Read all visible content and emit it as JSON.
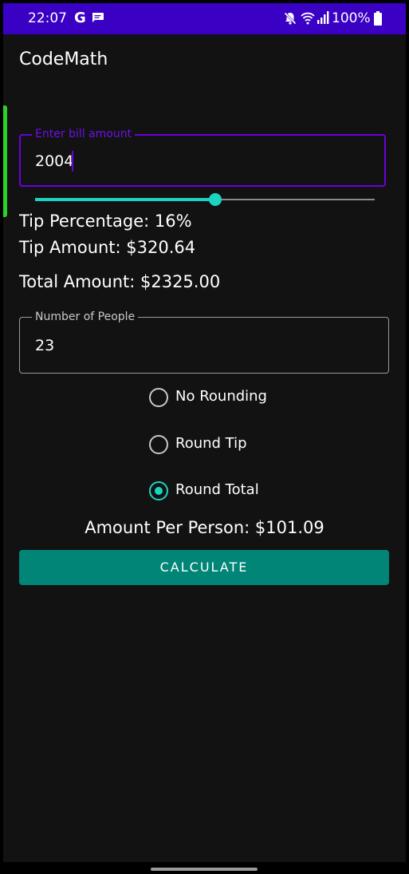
{
  "status_bar": {
    "time": "22:07",
    "google_letter": "G",
    "battery_percent": "100%",
    "icons": [
      "google-icon",
      "message-icon",
      "mute-icon",
      "wifi-icon",
      "signal-icon",
      "battery-icon"
    ],
    "background_color": "#3A00C4"
  },
  "app": {
    "title": "CodeMath"
  },
  "bill": {
    "label": "Enter bill amount",
    "value": "2004",
    "accent_color": "#6A00E0"
  },
  "tip_slider": {
    "value_fraction": 0.53,
    "color": "#1AD4C0"
  },
  "results": {
    "tip_percentage": "Tip Percentage: 16%",
    "tip_amount": "Tip Amount: $320.64",
    "total_amount": "Total Amount: $2325.00"
  },
  "people": {
    "label": "Number of People",
    "value": "23"
  },
  "rounding": {
    "options": [
      {
        "label": "No Rounding",
        "selected": false
      },
      {
        "label": "Round Tip",
        "selected": false
      },
      {
        "label": "Round Total",
        "selected": true
      }
    ]
  },
  "per_person": "Amount Per Person: $101.09",
  "calculate_button": {
    "label": "CALCULATE",
    "color": "#008577"
  }
}
